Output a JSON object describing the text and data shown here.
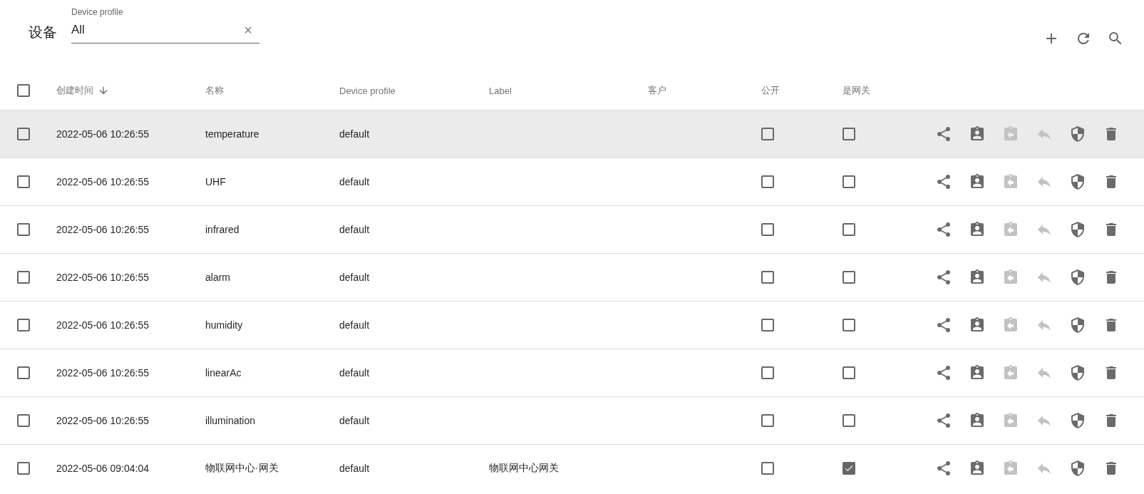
{
  "page": {
    "title": "设备"
  },
  "filter": {
    "label": "Device profile",
    "value": "All",
    "clear_symbol": "×"
  },
  "toolbar": [
    {
      "kind": "add"
    },
    {
      "kind": "refresh"
    },
    {
      "kind": "search"
    }
  ],
  "table": {
    "select_all_checked": false,
    "columns": [
      {
        "label": "创建时间",
        "sorted": true
      },
      {
        "label": "名称",
        "sorted": false
      },
      {
        "label": "Device profile",
        "sorted": false
      },
      {
        "label": "Label",
        "sorted": false
      },
      {
        "label": "客户",
        "sorted": false
      },
      {
        "label": "公开",
        "sorted": false
      },
      {
        "label": "是网关",
        "sorted": false
      }
    ],
    "actions": [
      {
        "kind": "share",
        "disabled": false
      },
      {
        "kind": "assign",
        "disabled": false
      },
      {
        "kind": "unassign",
        "disabled": true
      },
      {
        "kind": "private",
        "disabled": true
      },
      {
        "kind": "credentials",
        "disabled": false
      },
      {
        "kind": "delete",
        "disabled": false
      }
    ],
    "rows": [
      {
        "checked": false,
        "hovered": true,
        "created": "2022-05-06 10:26:55",
        "name": "temperature",
        "profile": "default",
        "label": "",
        "public": false,
        "gateway": false
      },
      {
        "checked": false,
        "hovered": false,
        "created": "2022-05-06 10:26:55",
        "name": "UHF",
        "profile": "default",
        "label": "",
        "public": false,
        "gateway": false
      },
      {
        "checked": false,
        "hovered": false,
        "created": "2022-05-06 10:26:55",
        "name": "infrared",
        "profile": "default",
        "label": "",
        "public": false,
        "gateway": false
      },
      {
        "checked": false,
        "hovered": false,
        "created": "2022-05-06 10:26:55",
        "name": "alarm",
        "profile": "default",
        "label": "",
        "public": false,
        "gateway": false
      },
      {
        "checked": false,
        "hovered": false,
        "created": "2022-05-06 10:26:55",
        "name": "humidity",
        "profile": "default",
        "label": "",
        "public": false,
        "gateway": false
      },
      {
        "checked": false,
        "hovered": false,
        "created": "2022-05-06 10:26:55",
        "name": "linearAc",
        "profile": "default",
        "label": "",
        "public": false,
        "gateway": false
      },
      {
        "checked": false,
        "hovered": false,
        "created": "2022-05-06 10:26:55",
        "name": "illumination",
        "profile": "default",
        "label": "",
        "public": false,
        "gateway": false
      },
      {
        "checked": false,
        "hovered": false,
        "created": "2022-05-06 09:04:04",
        "name": "物联网中心·网关",
        "profile": "default",
        "label": "物联网中心网关",
        "public": false,
        "gateway": true
      }
    ]
  }
}
